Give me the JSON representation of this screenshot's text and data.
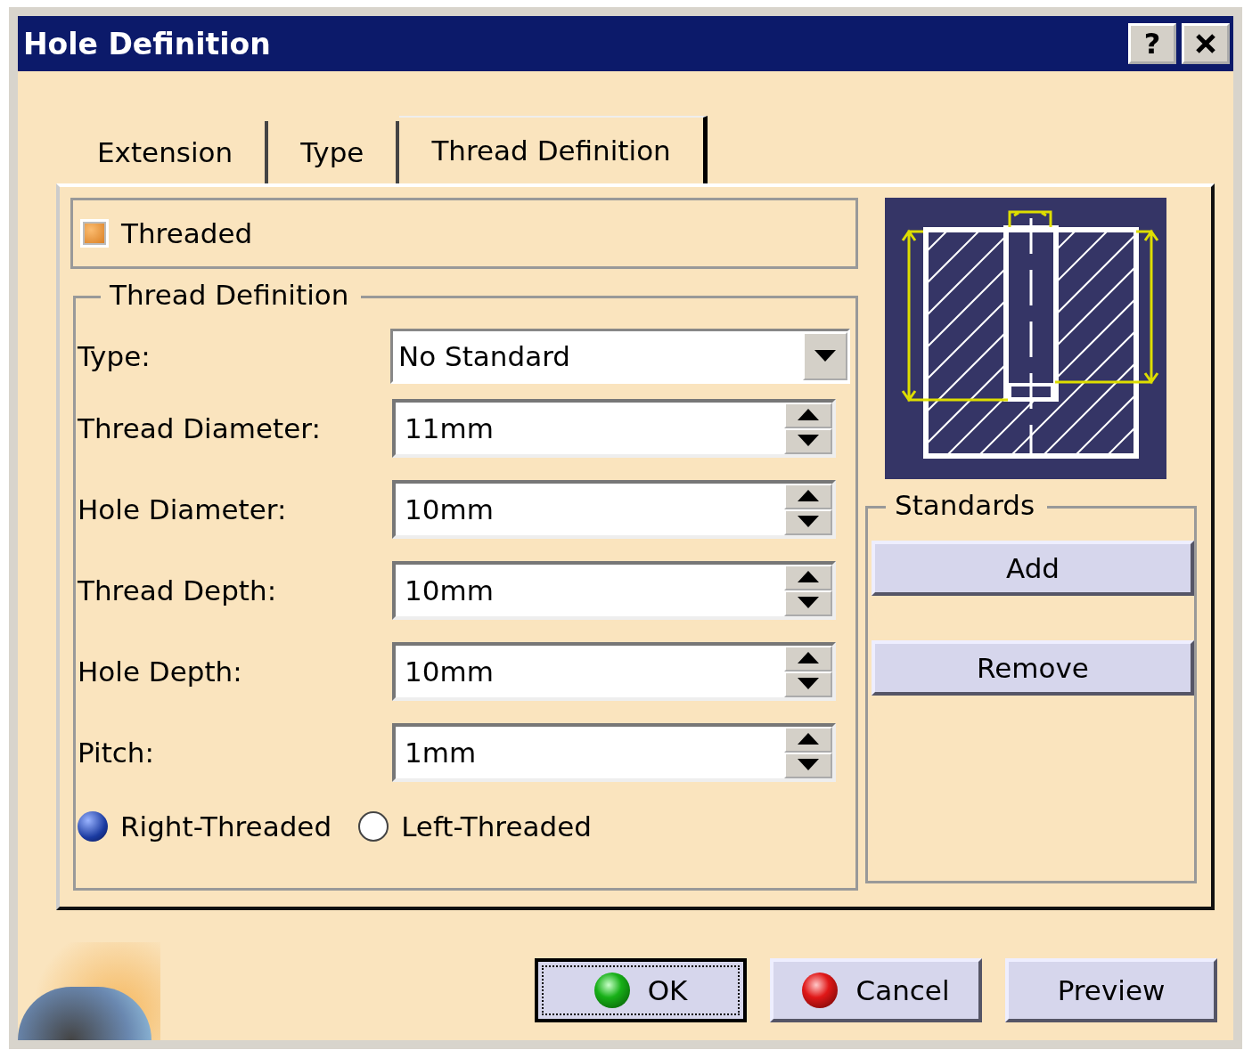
{
  "window": {
    "title": "Hole Definition",
    "help": "?"
  },
  "tabs": [
    {
      "label": "Extension",
      "selected": false
    },
    {
      "label": "Type",
      "selected": false
    },
    {
      "label": "Thread Definition",
      "selected": true
    }
  ],
  "threaded": {
    "label": "Threaded",
    "checked": true
  },
  "thread_definition": {
    "title": "Thread Definition",
    "type_label": "Type:",
    "type_value": "No Standard",
    "fields": [
      {
        "label": "Thread Diameter:",
        "value": "11mm"
      },
      {
        "label": "Hole Diameter:",
        "value": "10mm"
      },
      {
        "label": "Thread Depth:",
        "value": "10mm"
      },
      {
        "label": "Hole Depth:",
        "value": "10mm"
      },
      {
        "label": "Pitch:",
        "value": "1mm"
      }
    ],
    "radios": [
      {
        "label": "Right-Threaded",
        "selected": true
      },
      {
        "label": "Left-Threaded",
        "selected": false
      }
    ]
  },
  "standards": {
    "title": "Standards",
    "buttons": [
      "Add",
      "Remove"
    ]
  },
  "buttons": [
    {
      "label": "OK",
      "kind": "ok",
      "focused": true
    },
    {
      "label": "Cancel",
      "kind": "cancel",
      "focused": false
    },
    {
      "label": "Preview",
      "kind": "plain",
      "focused": false
    }
  ]
}
